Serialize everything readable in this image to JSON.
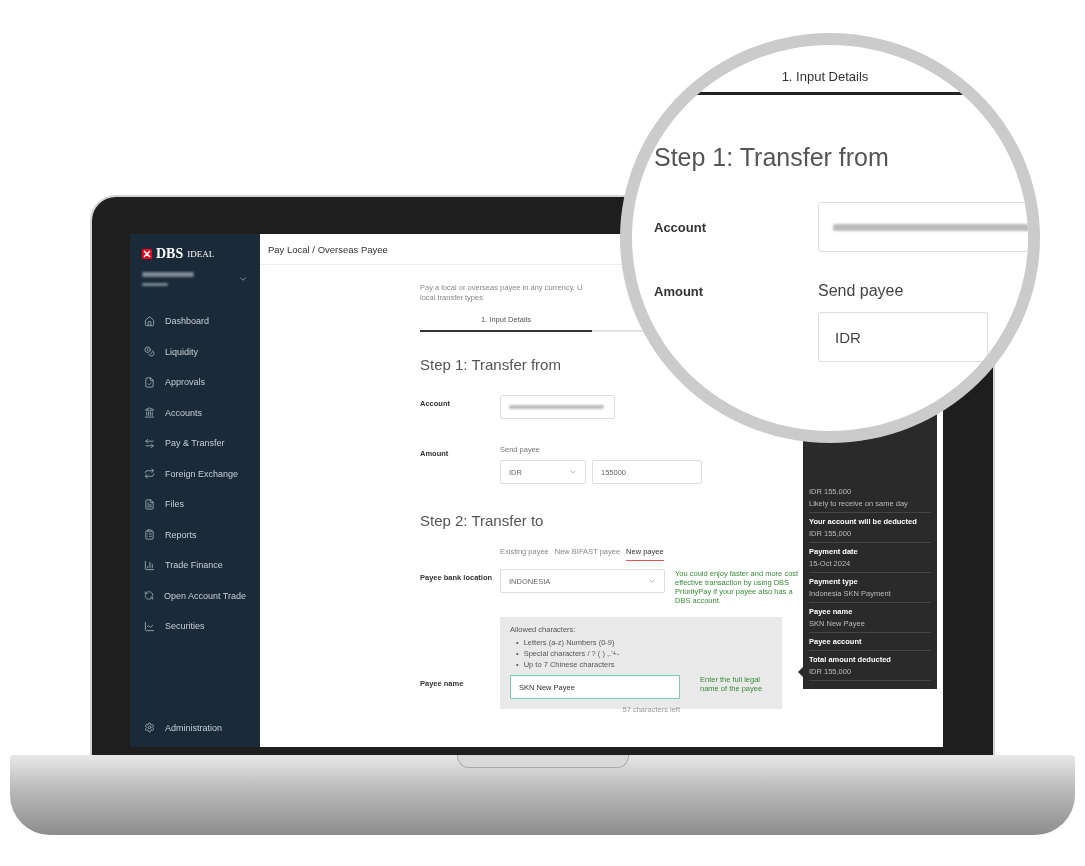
{
  "brand": {
    "name": "DBS",
    "product": "IDEAL"
  },
  "sidebar": {
    "items": [
      {
        "label": "Dashboard"
      },
      {
        "label": "Liquidity"
      },
      {
        "label": "Approvals"
      },
      {
        "label": "Accounts"
      },
      {
        "label": "Pay & Transfer"
      },
      {
        "label": "Foreign Exchange"
      },
      {
        "label": "Files"
      },
      {
        "label": "Reports"
      },
      {
        "label": "Trade Finance"
      },
      {
        "label": "Open Account Trade"
      },
      {
        "label": "Securities"
      }
    ],
    "footer": {
      "label": "Administration"
    }
  },
  "page": {
    "title": "Pay Local / Overseas Payee",
    "description": [
      "Pay a local or overseas payee in any currency. U",
      "local transfer types"
    ],
    "steps": [
      {
        "label": "1. Input Details",
        "selected": true
      }
    ],
    "step1": {
      "heading": "Step 1: Transfer from",
      "account_label": "Account",
      "amount_label": "Amount",
      "send_label": "Send payee",
      "currency": "IDR",
      "amount": "155000"
    },
    "step2": {
      "heading": "Step 2: Transfer to",
      "payee_tabs": [
        {
          "label": "Existing payee",
          "selected": false
        },
        {
          "label": "New BIFAST payee",
          "selected": false
        },
        {
          "label": "New payee",
          "selected": true
        }
      ],
      "location_label": "Payee bank location",
      "location": "INDONESIA",
      "location_hint": "You could enjoy faster and more cost effective transaction by using DBS PriorityPay if your payee also has a DBS account.",
      "allowed_title": "Allowed characters:",
      "bullet": "•",
      "allowed": [
        "Letters (a-z) Numbers (0-9)",
        "Special characters / ? ( ) ,.'+-",
        "Up to 7 Chinese characters"
      ],
      "name_label": "Payee name",
      "name_value": "SKN New Payee",
      "name_hint": "Enter the full legal name of the payee",
      "chars_left": "57 characters left"
    }
  },
  "summary": [
    {
      "lines": [
        "IDR 155,000",
        "Likely to receive on same day"
      ]
    },
    {
      "title": "Your account will be deducted",
      "lines": [
        "IDR 155,000"
      ]
    },
    {
      "title": "Payment date",
      "lines": [
        "15-Oct 2024"
      ]
    },
    {
      "title": "Payment type",
      "lines": [
        "Indonesia SKN Payment"
      ]
    },
    {
      "title": "Payee name",
      "lines": [
        "SKN New Payee"
      ]
    },
    {
      "title": "Payee account"
    },
    {
      "title": "Total amount deducted",
      "lines": [
        "IDR 155,000"
      ]
    }
  ],
  "magnifier": {
    "tab": {
      "label": "1. Input Details",
      "selected": true
    },
    "heading": "Step 1: Transfer from",
    "account_label": "Account",
    "amount_label": "Amount",
    "send_label": "Send payee",
    "currency": "IDR"
  }
}
